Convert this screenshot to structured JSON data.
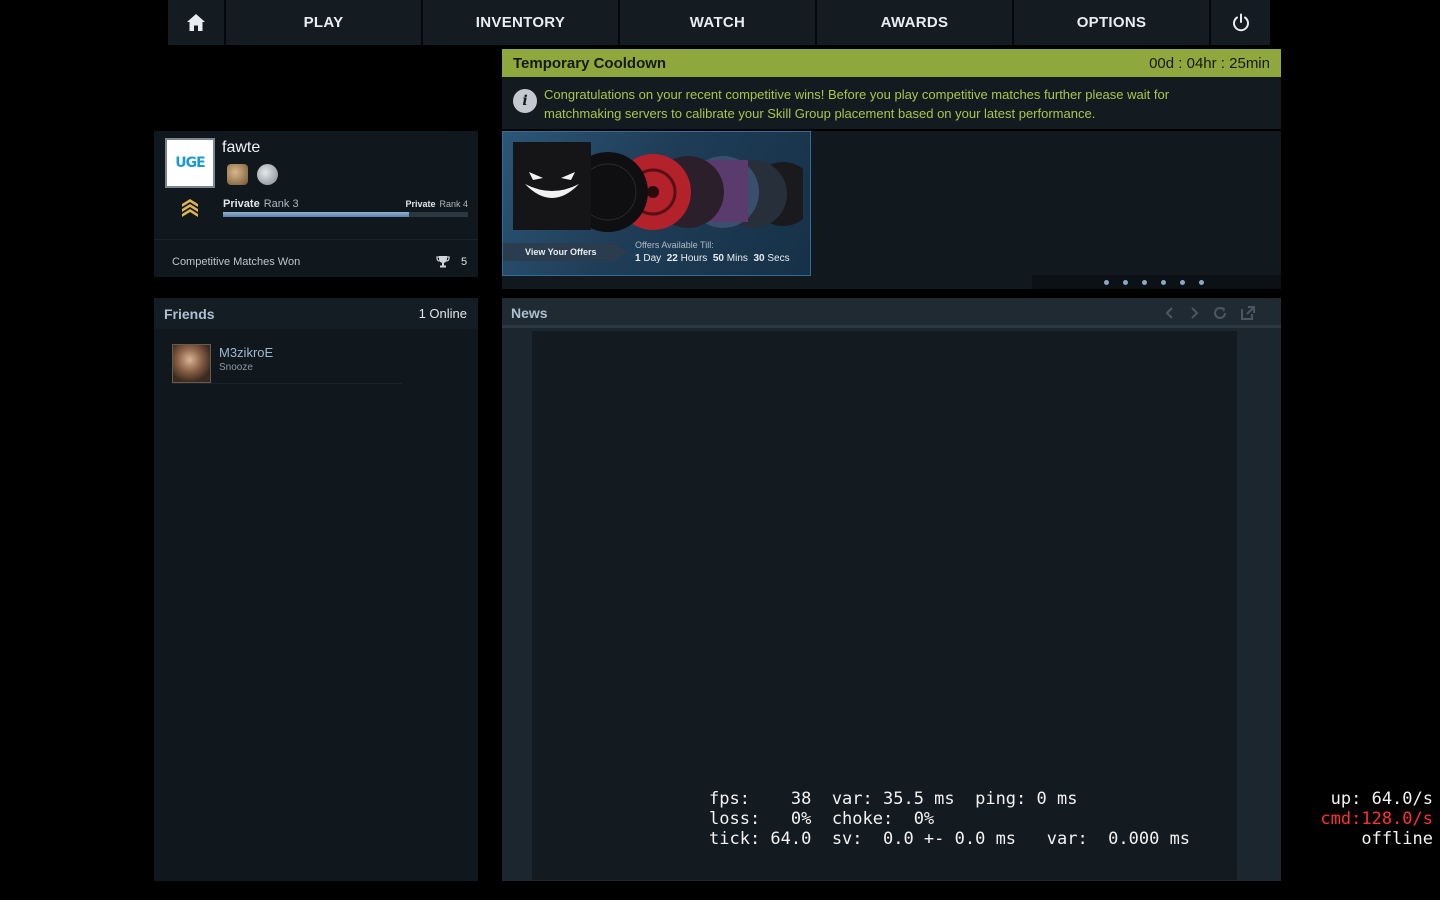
{
  "nav": {
    "home_icon": "home-icon",
    "play": "PLAY",
    "inventory": "INVENTORY",
    "watch": "WATCH",
    "awards": "AWARDS",
    "options": "OPTIONS",
    "power_icon": "power-icon"
  },
  "profile": {
    "avatar_text": "UGE",
    "name": "fawte",
    "rank_current": "Private",
    "rank_current_level": "Rank 3",
    "rank_next": "Private",
    "rank_next_level": "Rank 4",
    "rank_progress": 0.76,
    "competitive_label": "Competitive Matches Won",
    "competitive_wins": "5"
  },
  "cooldown": {
    "title": "Temporary Cooldown",
    "timer": "00d : 04hr : 25min",
    "message": "Congratulations on your recent competitive wins! Before you play competitive matches further please wait for matchmaking servers to calibrate your Skill Group placement based on your latest performance.",
    "accent": "#8fa83d"
  },
  "offers": {
    "button": "View Your Offers",
    "available_till": "Offers Available Till:",
    "days": "1",
    "days_label": "Day",
    "hours": "22",
    "hours_label": "Hours",
    "mins": "50",
    "mins_label": "Mins",
    "secs": "30",
    "secs_label": "Secs",
    "dot_count": 6
  },
  "friends": {
    "title": "Friends",
    "online": "1 Online",
    "list": [
      {
        "name": "M3zikroE",
        "status": "Snooze"
      }
    ]
  },
  "news": {
    "title": "News"
  },
  "netgraph": {
    "line1": "fps:    38  var: 35.5 ms  ping: 0 ms",
    "line2": "loss:   0%  choke:  0%",
    "line3": "tick: 64.0  sv:  0.0 +- 0.0 ms   var:  0.000 ms",
    "up": "up: 64.0/s",
    "cmd": "cmd:128.0/s",
    "status": "offline"
  }
}
